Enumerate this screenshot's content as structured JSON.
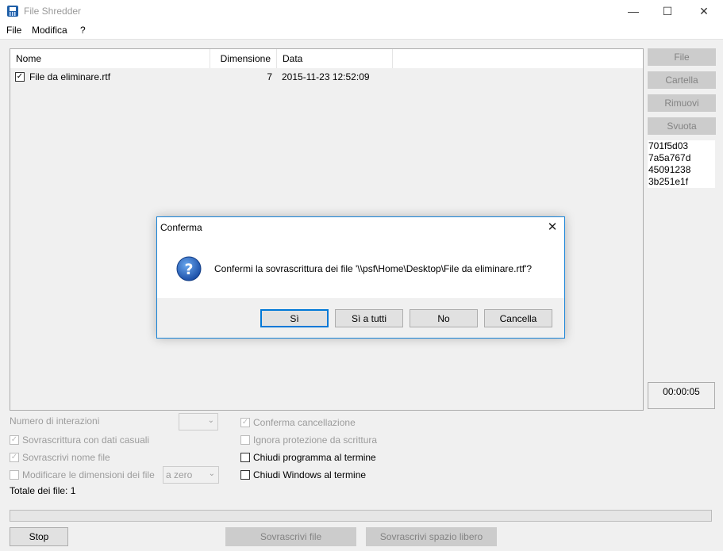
{
  "window": {
    "title": "File Shredder",
    "minimize": "—",
    "maximize": "☐",
    "close": "✕"
  },
  "menu": [
    "File",
    "Modifica",
    "?"
  ],
  "list": {
    "columns": [
      "Nome",
      "Dimensione",
      "Data"
    ],
    "rows": [
      {
        "checked": true,
        "name": "File da eliminare.rtf",
        "size": "7",
        "date": "2015-11-23 12:52:09"
      }
    ]
  },
  "side": {
    "buttons": [
      "File",
      "Cartella",
      "Rimuovi",
      "Svuota"
    ],
    "hash_lines": [
      "701f5d03",
      "7a5a767d",
      "45091238",
      "3b251e1f"
    ],
    "timer": "00:00:05"
  },
  "options": {
    "iterations_label": "Numero di interazioni",
    "iterations_value": "",
    "random_data": {
      "label": "Sovrascrittura con dati casuali",
      "checked": true,
      "enabled": false
    },
    "overwrite_name": {
      "label": "Sovrascrivi nome file",
      "checked": true,
      "enabled": false
    },
    "change_size": {
      "label": "Modificare le dimensioni dei file",
      "checked": false,
      "enabled": false
    },
    "size_mode": "a zero",
    "confirm_delete": {
      "label": "Conferma cancellazione",
      "checked": true,
      "enabled": false
    },
    "ignore_protect": {
      "label": "Ignora protezione da scrittura",
      "checked": false,
      "enabled": false
    },
    "close_program": {
      "label": "Chiudi programma al termine",
      "checked": false,
      "enabled": true
    },
    "close_windows": {
      "label": "Chiudi Windows al termine",
      "checked": false,
      "enabled": true
    },
    "total_files": "Totale dei file: 1"
  },
  "progress": 0,
  "bottom": {
    "stop": "Stop",
    "overwrite_files": "Sovrascrivi file",
    "overwrite_free": "Sovrascrivi spazio libero"
  },
  "dialog": {
    "title": "Conferma",
    "icon": "question-icon",
    "message": "Confermi la sovrascrittura dei file '\\\\psf\\Home\\Desktop\\File da eliminare.rtf'?",
    "buttons": [
      "Sì",
      "Sì a tutti",
      "No",
      "Cancella"
    ]
  },
  "colors": {
    "accent": "#0078d7",
    "dialog_border": "#1883d7",
    "disabled_text": "#9c9c9c"
  }
}
